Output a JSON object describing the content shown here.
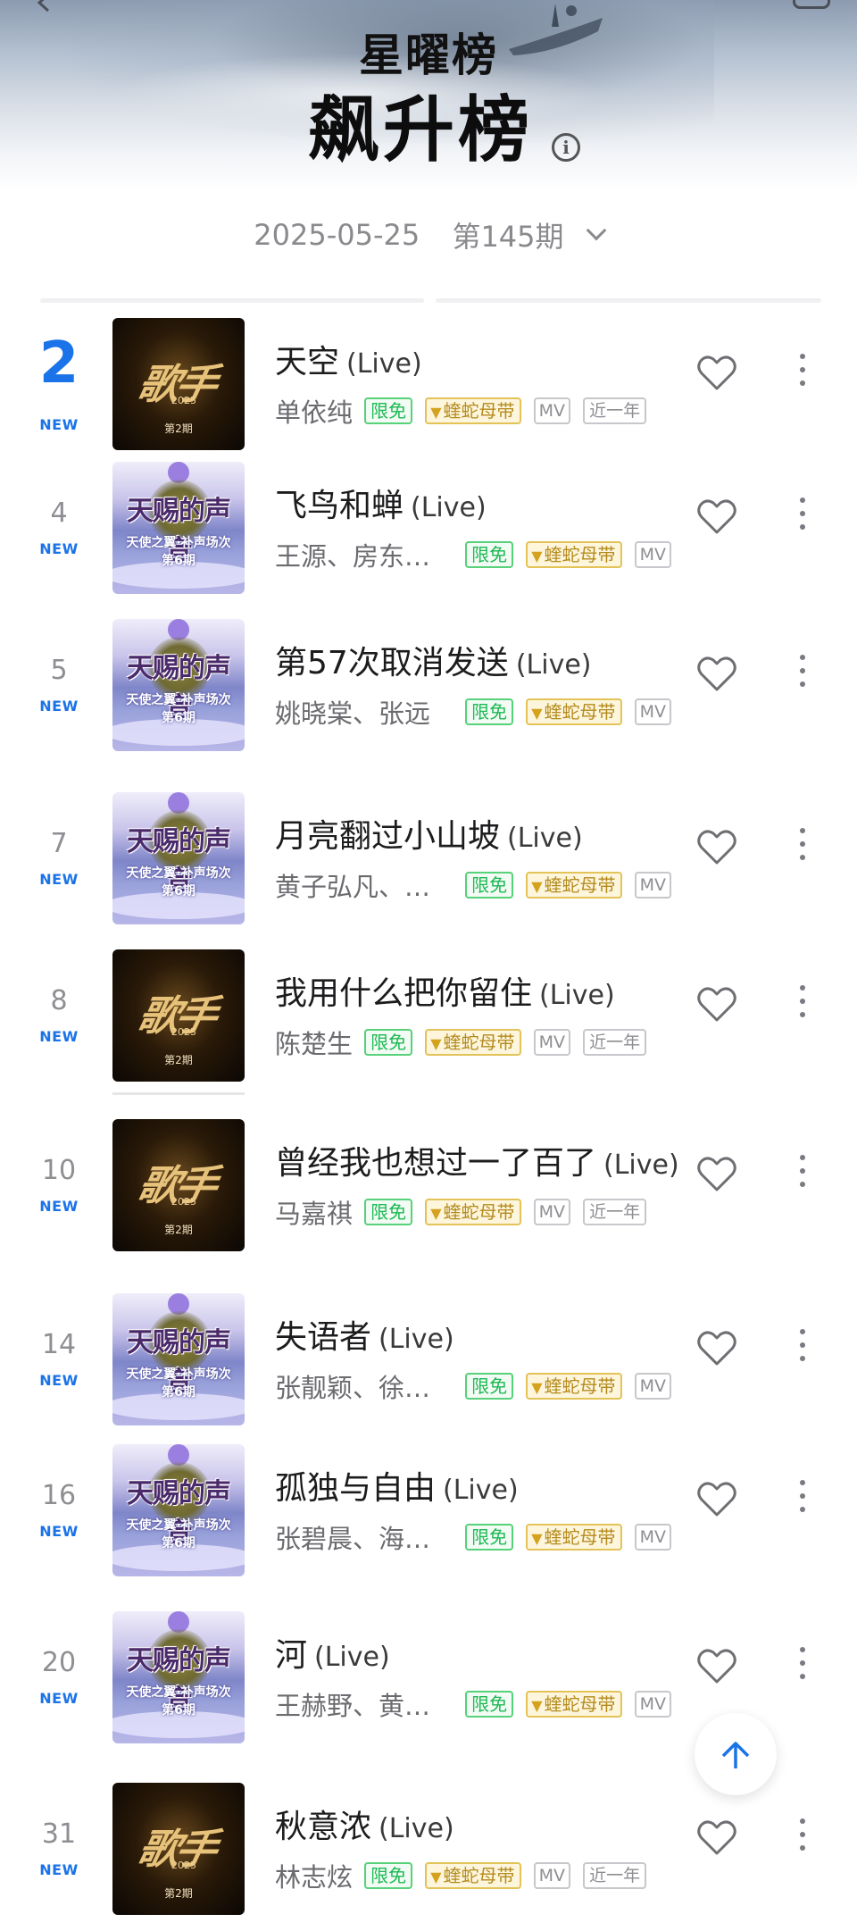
{
  "header": {
    "brand": "星曜榜",
    "title": "飙升榜",
    "date": "2025-05-25",
    "issue": "第145期"
  },
  "colors": {
    "accent": "#1a73e8",
    "free_tag": "#1db954",
    "vip_tag": "#b58a1c"
  },
  "tags": {
    "free": "限免",
    "vip": "蝰蛇母带",
    "mv": "MV",
    "year": "近一年"
  },
  "songs": [
    {
      "rank": "2",
      "badge": "NEW",
      "title": "天空",
      "suffix": "(Live)",
      "artist": "单依纯",
      "cover": "歌手",
      "cover_year": "2025",
      "cover_episode": "第2期",
      "has_year_tag": true
    },
    {
      "rank": "4",
      "badge": "NEW",
      "title": "飞鸟和蝉",
      "suffix": "(Live)",
      "artist": "王源、房东的猫",
      "cover": "天赐的声音",
      "cover_sub": "天使之翼·补声场次",
      "cover_episode": "第6期",
      "has_year_tag": false
    },
    {
      "rank": "5",
      "badge": "NEW",
      "title": "第57次取消发送",
      "suffix": "(Live)",
      "artist": "姚晓棠、张远",
      "cover": "天赐的声音",
      "cover_sub": "天使之翼·补声场次",
      "cover_episode": "第6期",
      "has_year_tag": false
    },
    {
      "rank": "7",
      "badge": "NEW",
      "title": "月亮翻过小山坡",
      "suffix": "(Live)",
      "artist": "黄子弘凡、单依纯",
      "cover": "天赐的声音",
      "cover_sub": "天使之翼·补声场次",
      "cover_episode": "第6期",
      "has_year_tag": false
    },
    {
      "rank": "8",
      "badge": "NEW",
      "title": "我用什么把你留住",
      "suffix": "(Live)",
      "artist": "陈楚生",
      "cover": "歌手",
      "cover_year": "2025",
      "cover_episode": "第2期",
      "has_year_tag": true
    },
    {
      "rank": "10",
      "badge": "NEW",
      "title": "曾经我也想过一了百了",
      "suffix": "(Live)",
      "artist": "马嘉祺",
      "cover": "歌手",
      "cover_year": "2025",
      "cover_episode": "第2期",
      "has_year_tag": true
    },
    {
      "rank": "14",
      "badge": "NEW",
      "title": "失语者",
      "suffix": "(Live)",
      "artist": "张靓颖、徐佳莹",
      "cover": "天赐的声音",
      "cover_sub": "天使之翼·补声场次",
      "cover_episode": "第6期",
      "has_year_tag": false
    },
    {
      "rank": "16",
      "badge": "NEW",
      "title": "孤独与自由",
      "suffix": "(Live)",
      "artist": "张碧晨、海来阿木",
      "cover": "天赐的声音",
      "cover_sub": "天使之翼·补声场次",
      "cover_episode": "第6期",
      "has_year_tag": false
    },
    {
      "rank": "20",
      "badge": "NEW",
      "title": "河",
      "suffix": "(Live)",
      "artist": "王赫野、黄霄雲",
      "cover": "天赐的声音",
      "cover_sub": "天使之翼·补声场次",
      "cover_episode": "第6期",
      "has_year_tag": false
    },
    {
      "rank": "31",
      "badge": "NEW",
      "title": "秋意浓",
      "suffix": "(Live)",
      "artist": "林志炫",
      "cover": "歌手",
      "cover_year": "2025",
      "cover_episode": "第2期",
      "has_year_tag": true
    }
  ]
}
